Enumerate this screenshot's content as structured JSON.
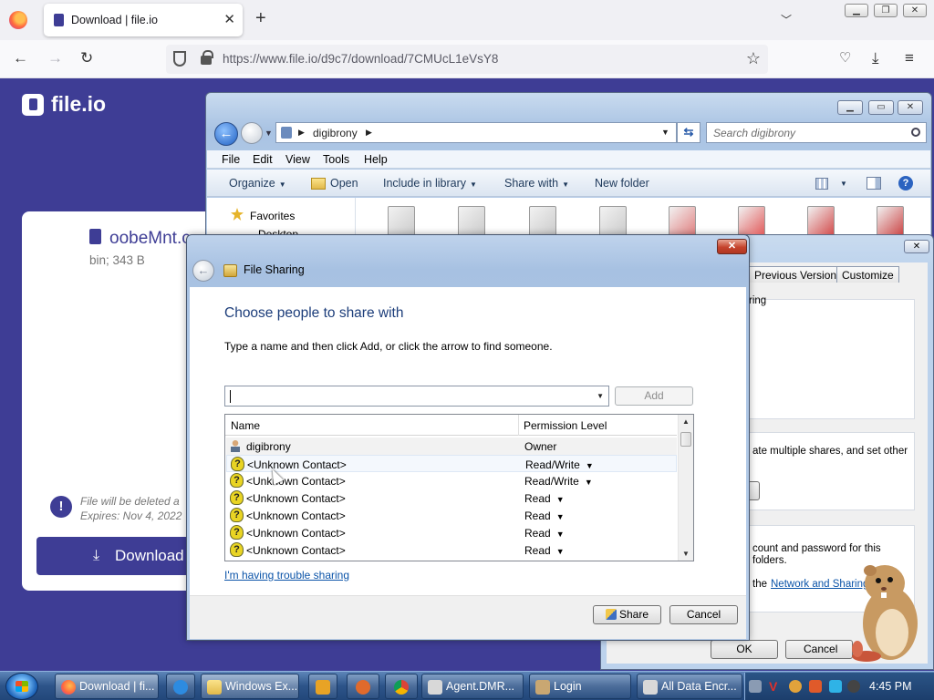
{
  "browser": {
    "tab_title": "Download | file.io",
    "url": "https://www.file.io/d9c7/download/7CMUcL1eVsY8"
  },
  "fileio": {
    "logo_text": "file.io",
    "file_name": "oobeMnt.c",
    "file_meta": "bin; 343 B",
    "warning_text": "File will be deleted a\nExpires: Nov 4, 2022",
    "download_label": "Download"
  },
  "explorer": {
    "breadcrumb": "digibrony",
    "search_placeholder": "Search digibrony",
    "menu": [
      "File",
      "Edit",
      "View",
      "Tools",
      "Help"
    ],
    "commands": {
      "organize": "Organize",
      "open": "Open",
      "include": "Include in library",
      "share": "Share with",
      "new_folder": "New folder"
    },
    "nav": {
      "favorites": "Favorites",
      "desktop": "Desktop"
    }
  },
  "properties": {
    "tabs": [
      "Previous Versions",
      "Customize"
    ],
    "text_sharing": "ring",
    "text_advanced": "ate multiple shares, and set other",
    "text_password_1": "count and password for this",
    "text_password_2": "folders.",
    "text_network_prefix": "the",
    "network_link": "Network and Sharing C",
    "ok": "OK",
    "cancel": "Cancel"
  },
  "file_sharing": {
    "title": "File Sharing",
    "heading": "Choose people to share with",
    "instruction": "Type a name and then click Add, or click the arrow to find someone.",
    "input_value": "",
    "add_label": "Add",
    "columns": [
      "Name",
      "Permission Level"
    ],
    "rows": [
      {
        "name": "digibrony",
        "permission": "Owner",
        "type": "user"
      },
      {
        "name": "<Unknown Contact>",
        "permission": "Read/Write",
        "type": "unknown"
      },
      {
        "name": "<Unknown Contact>",
        "permission": "Read/Write",
        "type": "unknown"
      },
      {
        "name": "<Unknown Contact>",
        "permission": "Read",
        "type": "unknown"
      },
      {
        "name": "<Unknown Contact>",
        "permission": "Read",
        "type": "unknown"
      },
      {
        "name": "<Unknown Contact>",
        "permission": "Read",
        "type": "unknown"
      },
      {
        "name": "<Unknown Contact>",
        "permission": "Read",
        "type": "unknown"
      }
    ],
    "trouble_link": "I'm having trouble sharing",
    "share_label": "Share",
    "cancel_label": "Cancel"
  },
  "taskbar": {
    "items": [
      "Download | fi...",
      "Windows Ex...",
      "Agent.DMR...",
      "Login",
      "All Data Encr..."
    ],
    "clock": "4:45 PM"
  }
}
